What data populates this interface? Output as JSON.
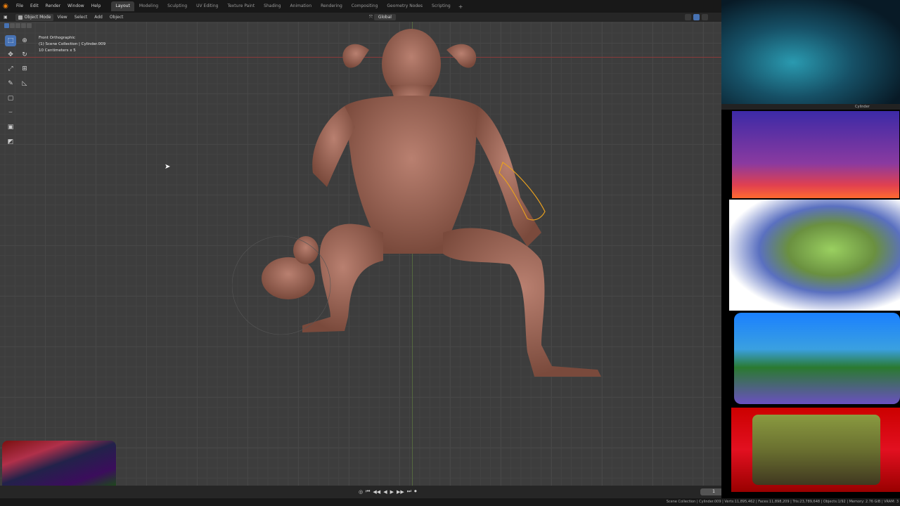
{
  "app": {
    "name": "Blender"
  },
  "menu": {
    "items": [
      "File",
      "Edit",
      "Render",
      "Window",
      "Help"
    ]
  },
  "workspaces": {
    "tabs": [
      "Layout",
      "Modeling",
      "Sculpting",
      "UV Editing",
      "Texture Paint",
      "Shading",
      "Animation",
      "Rendering",
      "Compositing",
      "Geometry Nodes",
      "Scripting"
    ],
    "active": "Layout",
    "add": "+"
  },
  "header": {
    "mode": "Object Mode",
    "view": "View",
    "select": "Select",
    "add": "Add",
    "object": "Object",
    "orientation": "Global"
  },
  "viewport": {
    "overlay_line1": "Front Orthographic",
    "overlay_line2": "(1) Scene Collection | Cylinder.009",
    "overlay_line3": "10 Centimeters x 5"
  },
  "timeline": {
    "current_frame": "1"
  },
  "status": {
    "text": "Scene Collection | Cylinder.009 | Verts:11,895,462 | Faces:11,898,209 | Tris:23,789,648 | Objects:1/92 | Memory: 2.76 GiB | VRAM: 3"
  },
  "side_panel": {
    "header_label": "Cylinder"
  },
  "icons": [
    "blender-logo-icon",
    "select-box-icon",
    "cursor-icon",
    "move-icon",
    "rotate-icon",
    "scale-icon",
    "transform-icon",
    "annotate-icon",
    "measure-icon",
    "add-cube-icon",
    "play-icon",
    "jump-start-icon",
    "jump-end-icon",
    "mouse-cursor-icon"
  ],
  "colors": {
    "accent": "#4772b3",
    "selection_outline": "#e8a020",
    "model": "#a8705c"
  }
}
